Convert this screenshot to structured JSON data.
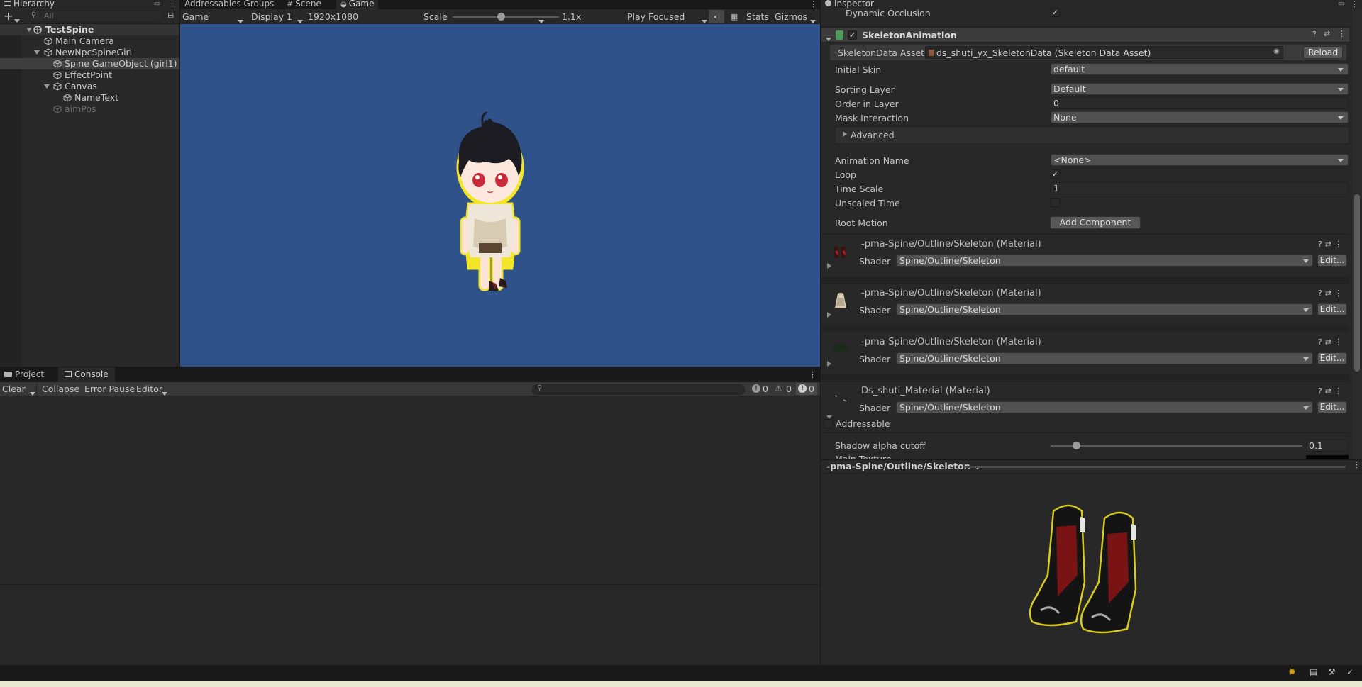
{
  "tabs": {
    "hierarchy": "Hierarchy",
    "addressables": "Addressables Groups",
    "scene": "Scene",
    "game": "Game",
    "inspector": "Inspector",
    "project": "Project",
    "console": "Console"
  },
  "hierarchy": {
    "search_placeholder": "All",
    "items": [
      {
        "label": "TestSpine",
        "depth": 0,
        "expanded": true,
        "bold": true,
        "active": true,
        "icon": "unity-scene-icon"
      },
      {
        "label": "Main Camera",
        "depth": 1,
        "active": true,
        "icon": "gameobject-icon"
      },
      {
        "label": "NewNpcSpineGirl",
        "depth": 1,
        "expanded": true,
        "active": true,
        "icon": "gameobject-icon"
      },
      {
        "label": "Spine GameObject (girl1)",
        "depth": 2,
        "active": true,
        "selected": true,
        "icon": "gameobject-icon"
      },
      {
        "label": "EffectPoint",
        "depth": 2,
        "active": true,
        "icon": "gameobject-icon"
      },
      {
        "label": "Canvas",
        "depth": 2,
        "expanded": true,
        "active": true,
        "icon": "gameobject-icon"
      },
      {
        "label": "NameText",
        "depth": 3,
        "active": true,
        "icon": "gameobject-icon"
      },
      {
        "label": "aimPos",
        "depth": 2,
        "active": false,
        "icon": "gameobject-icon"
      }
    ]
  },
  "game_toolbar": {
    "view": "Game",
    "display": "Display 1",
    "resolution": "1920x1080",
    "scale_label": "Scale",
    "scale_value": "1.1x",
    "scale_fraction": 0.45,
    "play_mode": "Play Focused",
    "stats": "Stats",
    "gizmos": "Gizmos"
  },
  "game_view": {
    "background": "#2e5289"
  },
  "console": {
    "clear": "Clear",
    "collapse": "Collapse",
    "error_pause": "Error Pause",
    "editor": "Editor",
    "counts": {
      "info": "0",
      "warn": "0",
      "error": "0"
    }
  },
  "inspector": {
    "dynamic_occlusion": "Dynamic Occlusion",
    "component_title": "SkeletonAnimation",
    "fields": {
      "skeleton_data_label": "SkeletonData Asset",
      "skeleton_data_value": "ds_shuti_yx_SkeletonData (Skeleton Data Asset)",
      "reload": "Reload",
      "initial_skin_label": "Initial Skin",
      "initial_skin_value": "default",
      "sorting_layer_label": "Sorting Layer",
      "sorting_layer_value": "Default",
      "order_label": "Order in Layer",
      "order_value": "0",
      "mask_label": "Mask Interaction",
      "mask_value": "None",
      "advanced": "Advanced",
      "anim_name_label": "Animation Name",
      "anim_name_value": "<None>",
      "loop_label": "Loop",
      "time_scale_label": "Time Scale",
      "time_scale_value": "1",
      "unscaled_label": "Unscaled Time",
      "root_motion_label": "Root Motion",
      "add_component": "Add Component"
    },
    "materials": [
      {
        "title": "-pma-Spine/Outline/Skeleton (Material)",
        "shader": "Spine/Outline/Skeleton",
        "thumb": "shoes-thumb"
      },
      {
        "title": "-pma-Spine/Outline/Skeleton (Material)",
        "shader": "Spine/Outline/Skeleton",
        "thumb": "dress-thumb"
      },
      {
        "title": "-pma-Spine/Outline/Skeleton (Material)",
        "shader": "Spine/Outline/Skeleton",
        "thumb": "hair-thumb"
      },
      {
        "title": "Ds_shuti_Material (Material)",
        "shader": "Spine/Outline/Skeleton",
        "thumb": "body-thumb"
      }
    ],
    "shader_label": "Shader",
    "edit_label": "Edit...",
    "addressable": "Addressable",
    "shadow_cutoff_label": "Shadow alpha cutoff",
    "shadow_cutoff_value": "0.1",
    "shadow_cutoff_fraction": 0.1,
    "main_texture_partial": "Main Texture"
  },
  "preview": {
    "title": "-pma-Spine/Outline/Skeleton"
  }
}
